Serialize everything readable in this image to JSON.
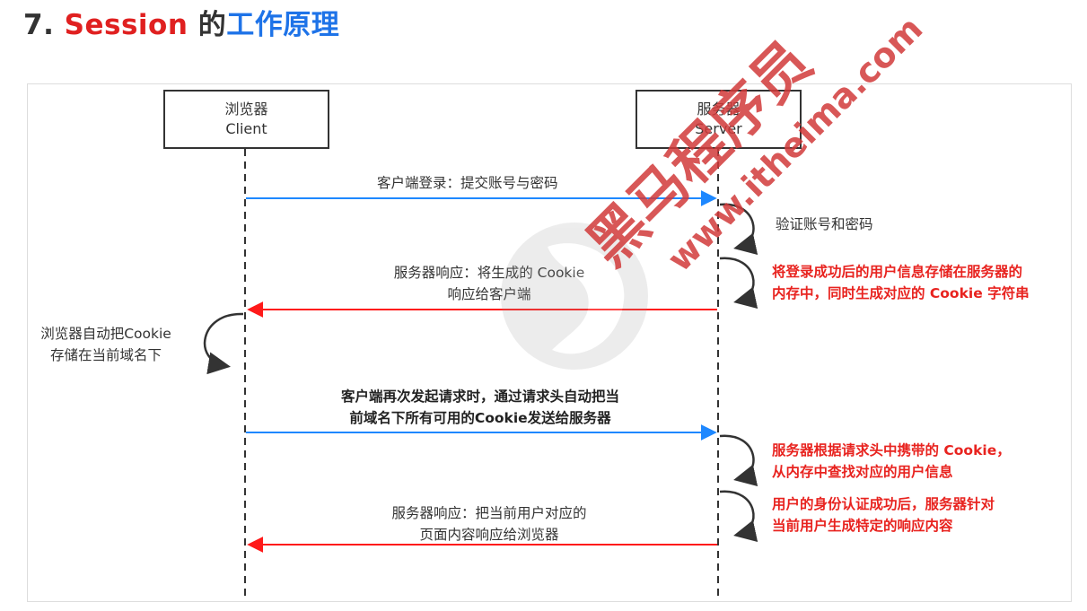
{
  "title": {
    "number": "7.",
    "keyword": "Session",
    "particle": "的",
    "rest": "工作原理"
  },
  "actors": {
    "client": {
      "name": "浏览器",
      "sub": "Client"
    },
    "server": {
      "name": "服务器",
      "sub": "Server"
    }
  },
  "messages": {
    "m1": "客户端登录：提交账号与密码",
    "m2_line1": "服务器响应：将生成的 Cookie",
    "m2_line2": "响应给客户端",
    "m3_line1": "客户端再次发起请求时，通过请求头自动把当",
    "m3_line2": "前域名下所有可用的Cookie发送给服务器",
    "m4_line1": "服务器响应：把当前用户对应的",
    "m4_line2": "页面内容响应给浏览器"
  },
  "notes": {
    "verify": "验证账号和密码",
    "store_line1": "将登录成功后的用户信息存储在服务器的",
    "store_line2": "内存中，同时生成对应的 Cookie 字符串",
    "browser_line1": "浏览器自动把Cookie",
    "browser_line2": "存储在当前域名下",
    "lookup_line1": "服务器根据请求头中携带的 Cookie，",
    "lookup_line2": "从内存中查找对应的用户信息",
    "auth_line1": "用户的身份认证成功后，服务器针对",
    "auth_line2": "当前用户生成特定的响应内容"
  },
  "watermark": {
    "brand": "黑马程序员",
    "url": "www.itheima.com"
  },
  "colors": {
    "request_arrow": "#1e88ff",
    "response_arrow": "#ff1a1a",
    "lifeline": "#333333"
  }
}
